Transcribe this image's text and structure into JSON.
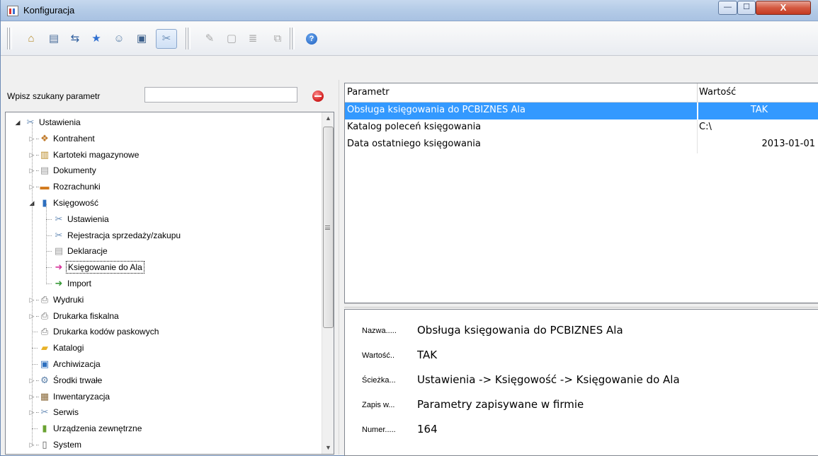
{
  "window": {
    "title": "Konfiguracja",
    "buttons": {
      "minimize": "—",
      "maximize": "☐",
      "close": "X"
    }
  },
  "toolbar": {
    "icons": [
      {
        "name": "home-icon",
        "glyph": "⌂"
      },
      {
        "name": "database-icon",
        "glyph": "▤"
      },
      {
        "name": "transfer-icon",
        "glyph": "⇆"
      },
      {
        "name": "star-icon",
        "glyph": "★"
      },
      {
        "name": "users-icon",
        "glyph": "☺"
      },
      {
        "name": "server-icon",
        "glyph": "▣"
      },
      {
        "name": "tools-icon",
        "glyph": "✂"
      },
      {
        "name": "edit-icon",
        "glyph": "✎"
      },
      {
        "name": "document-icon",
        "glyph": "▢"
      },
      {
        "name": "clipboard-icon",
        "glyph": "≣"
      },
      {
        "name": "copy-icon",
        "glyph": "⧉"
      },
      {
        "name": "help-icon",
        "glyph": "?"
      }
    ]
  },
  "search": {
    "label": "Wpisz szukany parametr",
    "value": "",
    "placeholder": ""
  },
  "tree": [
    {
      "label": "Ustawienia",
      "level": 0,
      "expander": "open",
      "icon": "tools-icon",
      "glyph": "✂",
      "color": "#6b8fb8"
    },
    {
      "label": "Kontrahent",
      "level": 1,
      "expander": "closed",
      "icon": "handshake-icon",
      "glyph": "❖",
      "color": "#c07a2a"
    },
    {
      "label": "Kartoteki magazynowe",
      "level": 1,
      "expander": "closed",
      "icon": "warehouse-icon",
      "glyph": "▥",
      "color": "#b98a26"
    },
    {
      "label": "Dokumenty",
      "level": 1,
      "expander": "closed",
      "icon": "document-icon",
      "glyph": "▤",
      "color": "#9a9a9a"
    },
    {
      "label": "Rozrachunki",
      "level": 1,
      "expander": "closed",
      "icon": "money-icon",
      "glyph": "▬",
      "color": "#d27a1e"
    },
    {
      "label": "Księgowość",
      "level": 1,
      "expander": "open",
      "icon": "book-icon",
      "glyph": "▮",
      "color": "#2d6fbf"
    },
    {
      "label": "Ustawienia",
      "level": 2,
      "expander": "none",
      "icon": "tools-icon",
      "glyph": "✂",
      "color": "#6b8fb8"
    },
    {
      "label": "Rejestracja sprzedaży/zakupu",
      "level": 2,
      "expander": "none",
      "icon": "tools-icon",
      "glyph": "✂",
      "color": "#6b8fb8"
    },
    {
      "label": "Deklaracje",
      "level": 2,
      "expander": "none",
      "icon": "declaration-icon",
      "glyph": "▤",
      "color": "#9a9a9a"
    },
    {
      "label": "Księgowanie do Ala",
      "level": 2,
      "expander": "none",
      "icon": "posting-icon",
      "glyph": "➜",
      "color": "#d6339a",
      "selected": true
    },
    {
      "label": "Import",
      "level": 2,
      "expander": "none",
      "icon": "import-icon",
      "glyph": "➜",
      "color": "#3a9a3a"
    },
    {
      "label": "Wydruki",
      "level": 1,
      "expander": "closed",
      "icon": "printer-icon",
      "glyph": "⎙",
      "color": "#6f6f6f"
    },
    {
      "label": "Drukarka fiskalna",
      "level": 1,
      "expander": "closed",
      "icon": "fiscal-printer-icon",
      "glyph": "⎙",
      "color": "#6f6f6f"
    },
    {
      "label": "Drukarka kodów paskowych",
      "level": 1,
      "expander": "none",
      "icon": "barcode-printer-icon",
      "glyph": "⎙",
      "color": "#6f6f6f"
    },
    {
      "label": "Katalogi",
      "level": 1,
      "expander": "none",
      "icon": "folder-icon",
      "glyph": "▰",
      "color": "#e8b227"
    },
    {
      "label": "Archiwizacja",
      "level": 1,
      "expander": "none",
      "icon": "floppy-icon",
      "glyph": "▣",
      "color": "#2d6fbf"
    },
    {
      "label": "Środki trwałe",
      "level": 1,
      "expander": "closed",
      "icon": "fixed-assets-icon",
      "glyph": "⚙",
      "color": "#5a7fa8"
    },
    {
      "label": "Inwentaryzacja",
      "level": 1,
      "expander": "closed",
      "icon": "inventory-icon",
      "glyph": "▦",
      "color": "#8a6a3a"
    },
    {
      "label": "Serwis",
      "level": 1,
      "expander": "closed",
      "icon": "service-icon",
      "glyph": "✂",
      "color": "#6b8fb8"
    },
    {
      "label": "Urządzenia zewnętrzne",
      "level": 1,
      "expander": "none",
      "icon": "device-icon",
      "glyph": "▮",
      "color": "#6aa232"
    },
    {
      "label": "System",
      "level": 1,
      "expander": "closed",
      "icon": "system-icon",
      "glyph": "▯",
      "color": "#555555"
    }
  ],
  "grid": {
    "columns": [
      "Parametr",
      "Wartość"
    ],
    "rows": [
      {
        "param": "Obsługa księgowania do PCBIZNES Ala",
        "value": "TAK",
        "align": "center",
        "selected": true
      },
      {
        "param": "Katalog poleceń księgowania",
        "value": "C:\\",
        "align": "left",
        "selected": false
      },
      {
        "param": "Data ostatniego księgowania",
        "value": "2013-01-01",
        "align": "right",
        "selected": false
      }
    ]
  },
  "details": [
    {
      "key": "Nazwa.....",
      "value": "Obsługa księgowania do PCBIZNES Ala"
    },
    {
      "key": "Wartość..",
      "value": "TAK"
    },
    {
      "key": "Ścieżka...",
      "value": "Ustawienia -> Księgowość -> Księgowanie do Ala"
    },
    {
      "key": "Zapis w...",
      "value": "Parametry zapisywane w firmie"
    },
    {
      "key": "Numer.....",
      "value": "164"
    }
  ],
  "colors": {
    "selection": "#3399ff",
    "titlebar": "#b4cbe7",
    "close_button": "#c43b22"
  }
}
